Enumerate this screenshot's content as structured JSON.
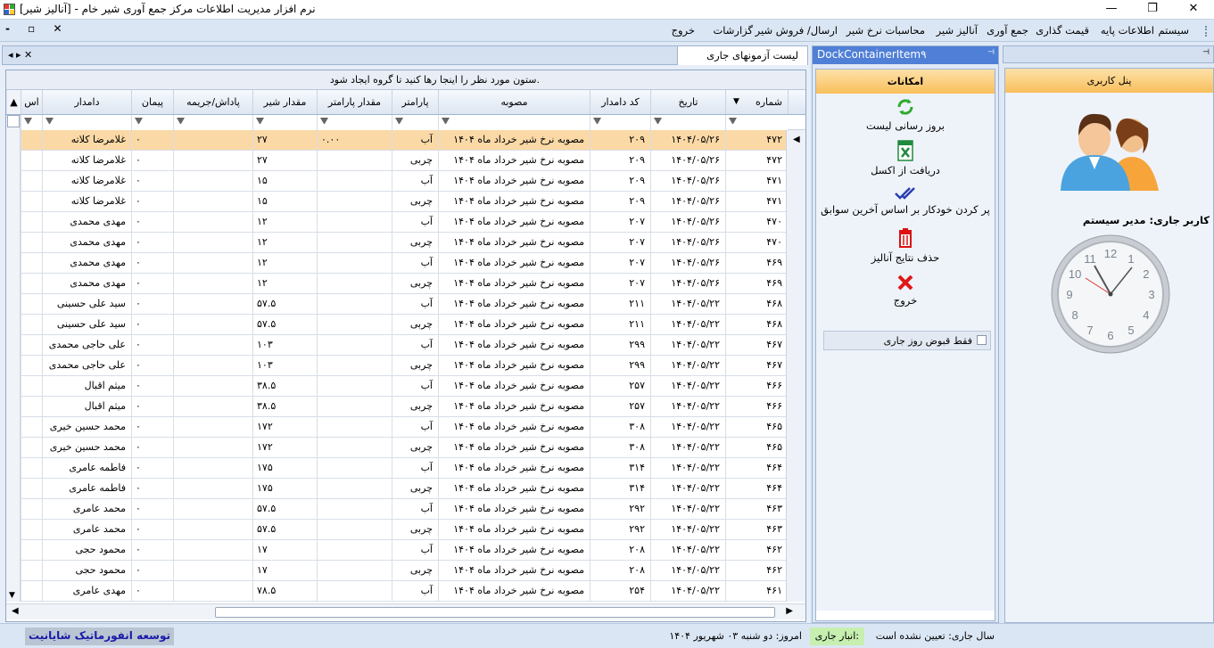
{
  "window": {
    "title": "نرم افزار مدیریت اطلاعات مرکز جمع آوری شیر خام - [آنالیز شیر]",
    "close": "✕",
    "maximize": "❐",
    "minimize": "—"
  },
  "menu": {
    "items": [
      "سیستم",
      "اطلاعات پایه",
      "قیمت گذاری",
      "جمع آوری",
      "آنالیز شیر",
      "محاسبات نرخ شیر",
      "ارسال/ فروش شیر",
      "گزارشات",
      "خروج"
    ],
    "mdi_controls": "-  ▫  ✕"
  },
  "tab": {
    "label": "لیست آزمونهای جاری",
    "nav": "◂ ▸ ✕"
  },
  "grid": {
    "group_hint": "ستون مورد نظر را اینجا رها کنید تا گروه ایجاد شود.",
    "headers": [
      "شماره",
      "تاریخ",
      "کد دامدار",
      "مصوبه",
      "پارامتر",
      "مقدار پارامتر",
      "مقدار شیر",
      "پاداش/جریمه",
      "پیمان",
      "دامدار",
      "اس"
    ],
    "rows": [
      [
        "۴۷۲",
        "۱۴۰۴/۰۵/۲۶",
        "۲۰۹",
        "مصوبه نرخ شیر خرداد ماه ۱۴۰۴",
        "آب",
        "۰.۰۰",
        "۲۷",
        "",
        "۰",
        "غلامرضا کلاته"
      ],
      [
        "۴۷۲",
        "۱۴۰۴/۰۵/۲۶",
        "۲۰۹",
        "مصوبه نرخ شیر خرداد ماه ۱۴۰۴",
        "چربی",
        "",
        "۲۷",
        "",
        "۰",
        "غلامرضا کلاته"
      ],
      [
        "۴۷۱",
        "۱۴۰۴/۰۵/۲۶",
        "۲۰۹",
        "مصوبه نرخ شیر خرداد ماه ۱۴۰۴",
        "آب",
        "",
        "۱۵",
        "",
        "۰",
        "غلامرضا کلاته"
      ],
      [
        "۴۷۱",
        "۱۴۰۴/۰۵/۲۶",
        "۲۰۹",
        "مصوبه نرخ شیر خرداد ماه ۱۴۰۴",
        "چربی",
        "",
        "۱۵",
        "",
        "۰",
        "غلامرضا کلاته"
      ],
      [
        "۴۷۰",
        "۱۴۰۴/۰۵/۲۶",
        "۲۰۷",
        "مصوبه نرخ شیر خرداد ماه ۱۴۰۴",
        "آب",
        "",
        "۱۲",
        "",
        "۰",
        "مهدی محمدی"
      ],
      [
        "۴۷۰",
        "۱۴۰۴/۰۵/۲۶",
        "۲۰۷",
        "مصوبه نرخ شیر خرداد ماه ۱۴۰۴",
        "چربی",
        "",
        "۱۲",
        "",
        "۰",
        "مهدی محمدی"
      ],
      [
        "۴۶۹",
        "۱۴۰۴/۰۵/۲۶",
        "۲۰۷",
        "مصوبه نرخ شیر خرداد ماه ۱۴۰۴",
        "آب",
        "",
        "۱۲",
        "",
        "۰",
        "مهدی محمدی"
      ],
      [
        "۴۶۹",
        "۱۴۰۴/۰۵/۲۶",
        "۲۰۷",
        "مصوبه نرخ شیر خرداد ماه ۱۴۰۴",
        "چربی",
        "",
        "۱۲",
        "",
        "۰",
        "مهدی محمدی"
      ],
      [
        "۴۶۸",
        "۱۴۰۴/۰۵/۲۲",
        "۲۱۱",
        "مصوبه نرخ شیر خرداد ماه ۱۴۰۴",
        "آب",
        "",
        "۵۷.۵",
        "",
        "۰",
        "سید علی حسینی"
      ],
      [
        "۴۶۸",
        "۱۴۰۴/۰۵/۲۲",
        "۲۱۱",
        "مصوبه نرخ شیر خرداد ماه ۱۴۰۴",
        "چربی",
        "",
        "۵۷.۵",
        "",
        "۰",
        "سید علی حسینی"
      ],
      [
        "۴۶۷",
        "۱۴۰۴/۰۵/۲۲",
        "۲۹۹",
        "مصوبه نرخ شیر خرداد ماه ۱۴۰۴",
        "آب",
        "",
        "۱۰۳",
        "",
        "۰",
        "علی حاجی محمدی"
      ],
      [
        "۴۶۷",
        "۱۴۰۴/۰۵/۲۲",
        "۲۹۹",
        "مصوبه نرخ شیر خرداد ماه ۱۴۰۴",
        "چربی",
        "",
        "۱۰۳",
        "",
        "۰",
        "علی حاجی محمدی"
      ],
      [
        "۴۶۶",
        "۱۴۰۴/۰۵/۲۲",
        "۲۵۷",
        "مصوبه نرخ شیر خرداد ماه ۱۴۰۴",
        "آب",
        "",
        "۳۸.۵",
        "",
        "۰",
        "میثم اقبال"
      ],
      [
        "۴۶۶",
        "۱۴۰۴/۰۵/۲۲",
        "۲۵۷",
        "مصوبه نرخ شیر خرداد ماه ۱۴۰۴",
        "چربی",
        "",
        "۳۸.۵",
        "",
        "۰",
        "میثم اقبال"
      ],
      [
        "۴۶۵",
        "۱۴۰۴/۰۵/۲۲",
        "۳۰۸",
        "مصوبه نرخ شیر خرداد ماه ۱۴۰۴",
        "آب",
        "",
        "۱۷۲",
        "",
        "۰",
        "محمد حسین خیری"
      ],
      [
        "۴۶۵",
        "۱۴۰۴/۰۵/۲۲",
        "۳۰۸",
        "مصوبه نرخ شیر خرداد ماه ۱۴۰۴",
        "چربی",
        "",
        "۱۷۲",
        "",
        "۰",
        "محمد حسین خیری"
      ],
      [
        "۴۶۴",
        "۱۴۰۴/۰۵/۲۲",
        "۳۱۴",
        "مصوبه نرخ شیر خرداد ماه ۱۴۰۴",
        "آب",
        "",
        "۱۷۵",
        "",
        "۰",
        "فاطمه عامری"
      ],
      [
        "۴۶۴",
        "۱۴۰۴/۰۵/۲۲",
        "۳۱۴",
        "مصوبه نرخ شیر خرداد ماه ۱۴۰۴",
        "چربی",
        "",
        "۱۷۵",
        "",
        "۰",
        "فاطمه عامری"
      ],
      [
        "۴۶۳",
        "۱۴۰۴/۰۵/۲۲",
        "۲۹۲",
        "مصوبه نرخ شیر خرداد ماه ۱۴۰۴",
        "آب",
        "",
        "۵۷.۵",
        "",
        "۰",
        "محمد عامری"
      ],
      [
        "۴۶۳",
        "۱۴۰۴/۰۵/۲۲",
        "۲۹۲",
        "مصوبه نرخ شیر خرداد ماه ۱۴۰۴",
        "چربی",
        "",
        "۵۷.۵",
        "",
        "۰",
        "محمد عامری"
      ],
      [
        "۴۶۲",
        "۱۴۰۴/۰۵/۲۲",
        "۲۰۸",
        "مصوبه نرخ شیر خرداد ماه ۱۴۰۴",
        "آب",
        "",
        "۱۷",
        "",
        "۰",
        "محمود حجی"
      ],
      [
        "۴۶۲",
        "۱۴۰۴/۰۵/۲۲",
        "۲۰۸",
        "مصوبه نرخ شیر خرداد ماه ۱۴۰۴",
        "چربی",
        "",
        "۱۷",
        "",
        "۰",
        "محمود حجی"
      ],
      [
        "۴۶۱",
        "۱۴۰۴/۰۵/۲۲",
        "۲۵۴",
        "مصوبه نرخ شیر خرداد ماه ۱۴۰۴",
        "آب",
        "",
        "۷۸.۵",
        "",
        "۰",
        "مهدی عامری"
      ]
    ]
  },
  "dock": {
    "title": "DockContainerItem۹",
    "pin": "📌",
    "section": "امکانات",
    "actions": [
      {
        "label": "بروز رسانی لیست",
        "icon": "refresh-icon"
      },
      {
        "label": "دریافت از اکسل",
        "icon": "excel-icon"
      },
      {
        "label": "پر کردن خودکار بر اساس آخرین سوابق",
        "icon": "checkmark-icon"
      },
      {
        "label": "حذف نتایج آنالیز",
        "icon": "trash-icon"
      },
      {
        "label": "خروج",
        "icon": "close-icon"
      }
    ],
    "checkbox_label": "فقط قبوض روز جاری"
  },
  "user_panel": {
    "title": "پنل کاربری",
    "current_user": "کاربر جاری: مدیر سیستم",
    "clock_numbers": [
      "12",
      "1",
      "2",
      "3",
      "4",
      "5",
      "6",
      "7",
      "8",
      "9",
      "10",
      "11"
    ]
  },
  "status": {
    "year": "سال جاری: تعیین نشده است",
    "warehouse": "انبار جاری:",
    "today": "امروز: دو شنبه ۰۳ شهریور ۱۴۰۴",
    "developer": "توسعه انفورماتیک شایانیت"
  },
  "colors": {
    "selected_row": "#fbd9a6",
    "panel_header": "#4f7fd6",
    "orange_header": "#fbc570",
    "status_green": "#c6efb0",
    "developer_text": "#1a1aa8"
  }
}
